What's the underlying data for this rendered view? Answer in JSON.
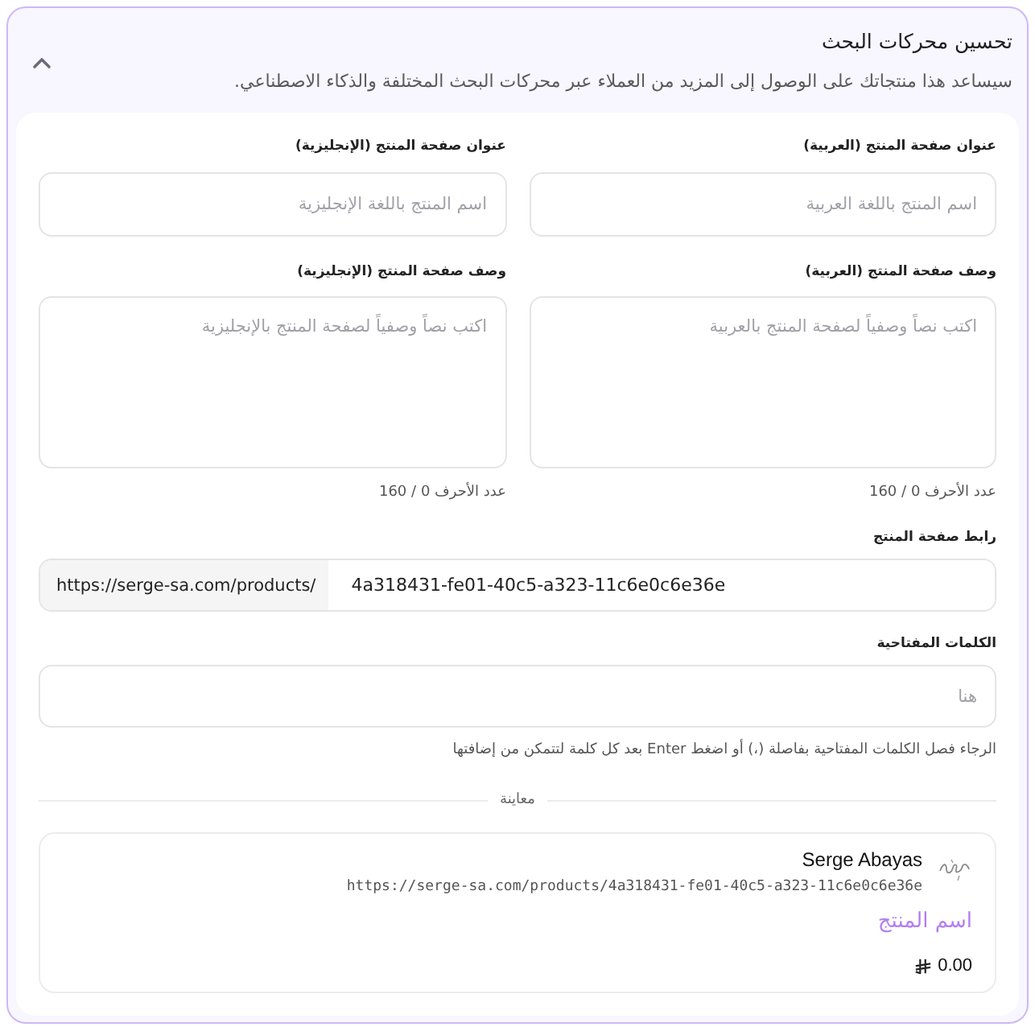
{
  "section": {
    "title": "تحسين محركات البحث",
    "subtitle": "سيساعد هذا منتجاتك على الوصول إلى المزيد من العملاء عبر محركات البحث المختلفة والذكاء الاصطناعي.",
    "expanded": true
  },
  "title_fields": [
    {
      "label": "عنوان صفحة المنتج (العربية)",
      "placeholder": "اسم المنتج باللغة العربية"
    },
    {
      "label": "عنوان صفحة المنتج (الإنجليزية)",
      "placeholder": "اسم المنتج باللغة الإنجليزية"
    }
  ],
  "description_fields": [
    {
      "label": "وصف صفحة المنتج (العربية)",
      "placeholder": "اكتب نصاً وصفياً لصفحة المنتج بالعربية",
      "counter": "عدد الأحرف 0 / 160"
    },
    {
      "label": "وصف صفحة المنتج (الإنجليزية)",
      "placeholder": "اكتب نصاً وصفياً لصفحة المنتج بالإنجليزية",
      "counter": "عدد الأحرف 0 / 160"
    }
  ],
  "url_field": {
    "label": "رابط صفحة المنتج",
    "prefix": "https://serge-sa.com/products/",
    "value": "4a318431-fe01-40c5-a323-11c6e0c6e36e"
  },
  "keywords_field": {
    "label": "الكلمات المفتاحية",
    "placeholder": "هنا",
    "hint": "الرجاء فصل الكلمات المفتاحية بفاصلة (،) أو اضغط Enter بعد كل كلمة لتتمكن من إضافتها"
  },
  "preview": {
    "label": "معاينة",
    "store_name": "Serge Abayas",
    "url": "https://serge-sa.com/products/4a318431-fe01-40c5-a323-11c6e0c6e36e",
    "product_name": "اسم المنتج",
    "price": "0.00"
  }
}
